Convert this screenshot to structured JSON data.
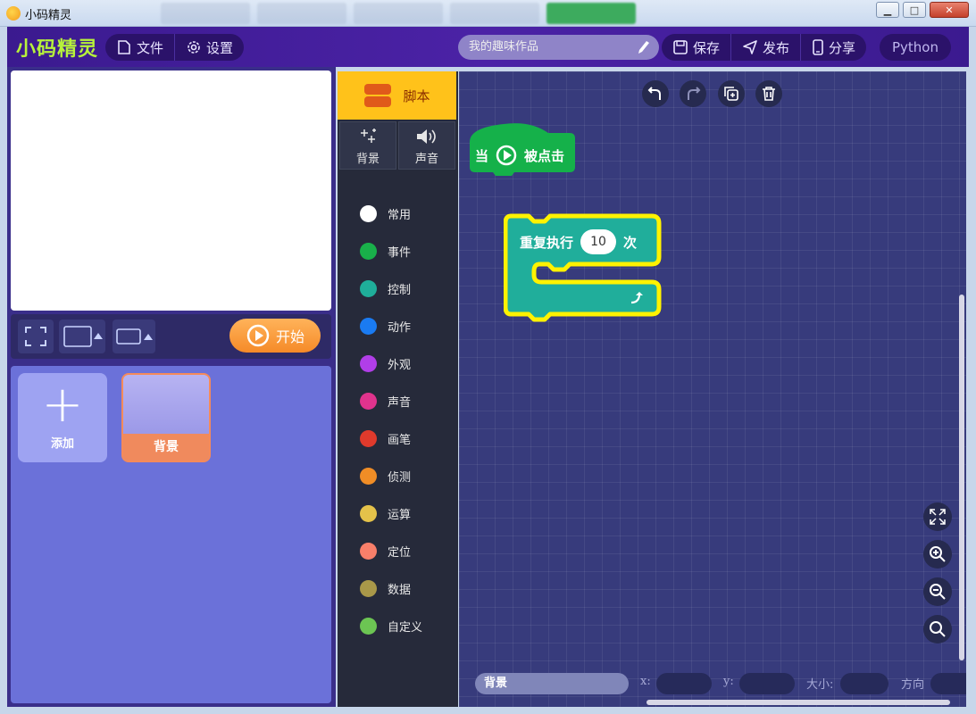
{
  "window": {
    "title": "小码精灵",
    "min": "▁",
    "max": "□",
    "close": "✕"
  },
  "appbar": {
    "logo": "小码精灵",
    "file_label": "文件",
    "settings_label": "设置",
    "project_name": "我的趣味作品",
    "save_label": "保存",
    "publish_label": "发布",
    "share_label": "分享",
    "python_label": "Python"
  },
  "stage": {
    "start_label": "开始"
  },
  "sprites": {
    "add_label": "添加",
    "background_label": "背景"
  },
  "tabs": {
    "script_label": "脚本",
    "backdrop_label": "背景",
    "sound_label": "声音"
  },
  "categories": [
    {
      "label": "常用",
      "color": "#ffffff"
    },
    {
      "label": "事件",
      "color": "#19b04a"
    },
    {
      "label": "控制",
      "color": "#1fae9a"
    },
    {
      "label": "动作",
      "color": "#1a7bf2"
    },
    {
      "label": "外观",
      "color": "#b13ee8"
    },
    {
      "label": "声音",
      "color": "#e0338d"
    },
    {
      "label": "画笔",
      "color": "#e03a2c"
    },
    {
      "label": "侦测",
      "color": "#f08d26"
    },
    {
      "label": "运算",
      "color": "#e4c24a"
    },
    {
      "label": "定位",
      "color": "#f87f6a"
    },
    {
      "label": "数据",
      "color": "#a99849"
    },
    {
      "label": "自定义",
      "color": "#6cc553"
    }
  ],
  "blocks": {
    "hat": {
      "prefix": "当",
      "suffix": "被点击"
    },
    "repeat": {
      "prefix": "重复执行",
      "count": "10",
      "suffix": "次"
    }
  },
  "bottom": {
    "sprite_name": "背景",
    "x_label": "x:",
    "y_label": "y:",
    "size_label": "大小:",
    "direction_label": "方向"
  }
}
